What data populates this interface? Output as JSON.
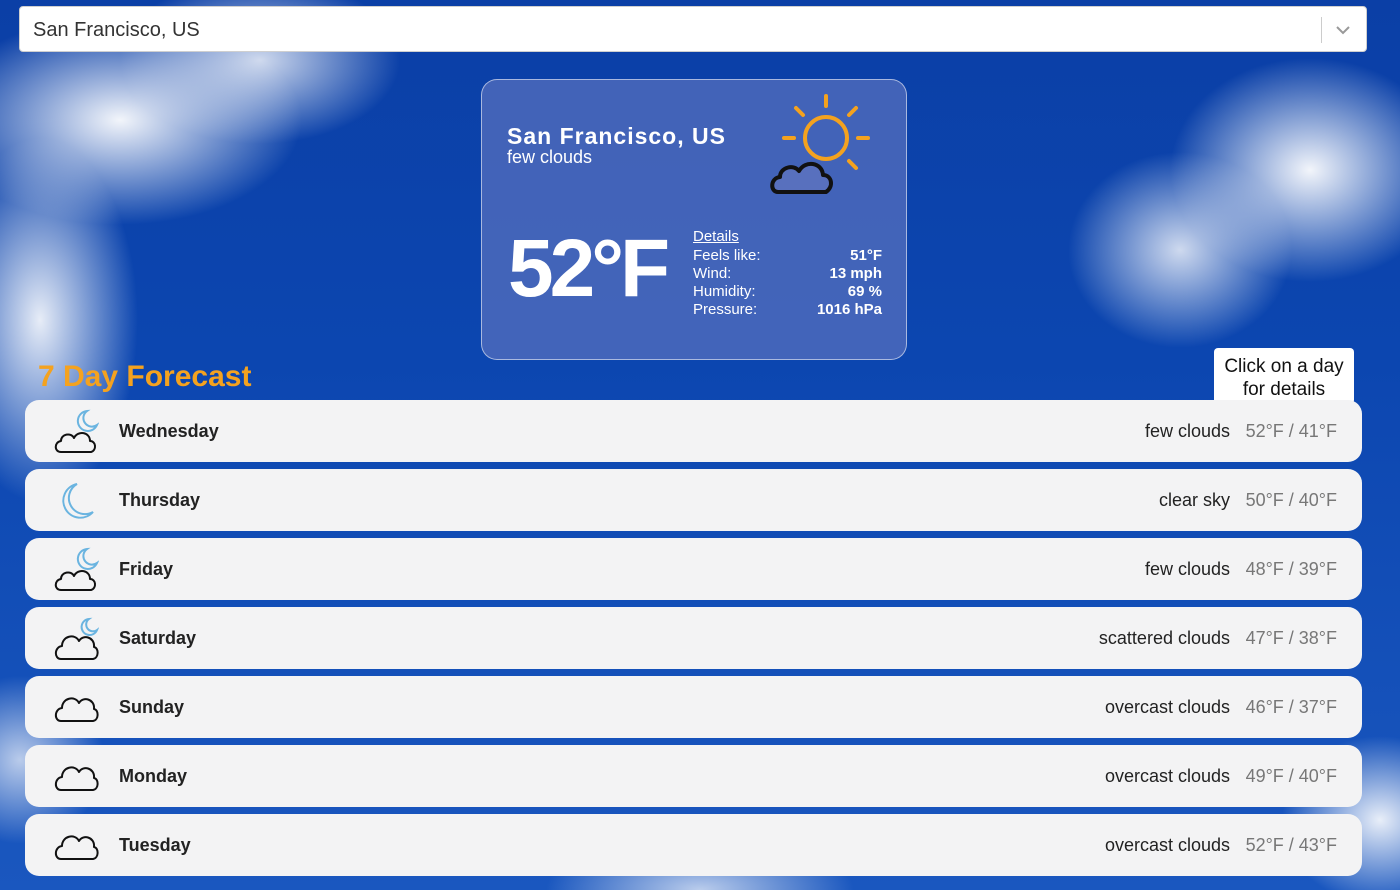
{
  "search": {
    "selected_value": "San Francisco, US"
  },
  "current": {
    "city": "San Francisco, US",
    "description": "few clouds",
    "temperature": "52°F",
    "icon": "sun-cloud-icon",
    "details_label": "Details",
    "details": [
      {
        "label": "Feels like:",
        "value": "51°F"
      },
      {
        "label": "Wind:",
        "value": "13 mph"
      },
      {
        "label": "Humidity:",
        "value": "69 %"
      },
      {
        "label": "Pressure:",
        "value": "1016 hPa"
      }
    ]
  },
  "forecast": {
    "title": "7 Day Forecast",
    "hint": "Click on a day for details",
    "days": [
      {
        "day": "Wednesday",
        "condition": "few clouds",
        "range": "52°F / 41°F",
        "icon": "moon-cloud-icon"
      },
      {
        "day": "Thursday",
        "condition": "clear sky",
        "range": "50°F / 40°F",
        "icon": "moon-icon"
      },
      {
        "day": "Friday",
        "condition": "few clouds",
        "range": "48°F / 39°F",
        "icon": "moon-cloud-icon"
      },
      {
        "day": "Saturday",
        "condition": "scattered clouds",
        "range": "47°F / 38°F",
        "icon": "moon-cloud-icon"
      },
      {
        "day": "Sunday",
        "condition": "overcast clouds",
        "range": "46°F / 37°F",
        "icon": "cloud-icon"
      },
      {
        "day": "Monday",
        "condition": "overcast clouds",
        "range": "49°F / 40°F",
        "icon": "cloud-icon"
      },
      {
        "day": "Tuesday",
        "condition": "overcast clouds",
        "range": "52°F / 43°F",
        "icon": "cloud-icon"
      }
    ]
  },
  "colors": {
    "accent": "#f4a21f",
    "sky": "#0c46b0",
    "card": "#5870be",
    "row_bg": "#f3f3f4",
    "moon": "#6ab4e0"
  }
}
